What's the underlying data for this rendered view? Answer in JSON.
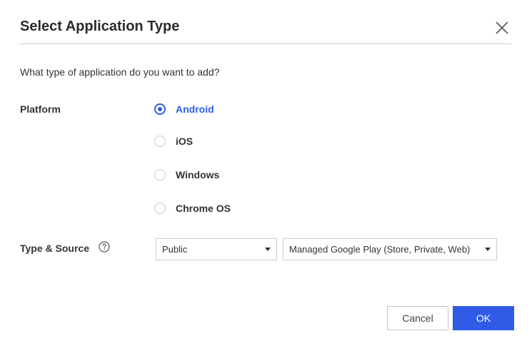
{
  "dialog": {
    "title": "Select Application Type",
    "question": "What type of application do you want to add?"
  },
  "platform": {
    "label": "Platform",
    "selected": "Android",
    "options": [
      {
        "label": "Android",
        "checked": true
      },
      {
        "label": "iOS",
        "checked": false
      },
      {
        "label": "Windows",
        "checked": false
      },
      {
        "label": "Chrome OS",
        "checked": false
      }
    ]
  },
  "type_source": {
    "label": "Type & Source",
    "type_value": "Public",
    "source_value": "Managed Google Play (Store, Private, Web)"
  },
  "buttons": {
    "cancel": "Cancel",
    "ok": "OK"
  },
  "icons": {
    "close": "close-icon",
    "help": "help-icon",
    "caret": "chevron-down-icon"
  },
  "colors": {
    "accent": "#2f5be7",
    "text": "#333333",
    "border": "#cccccc"
  }
}
